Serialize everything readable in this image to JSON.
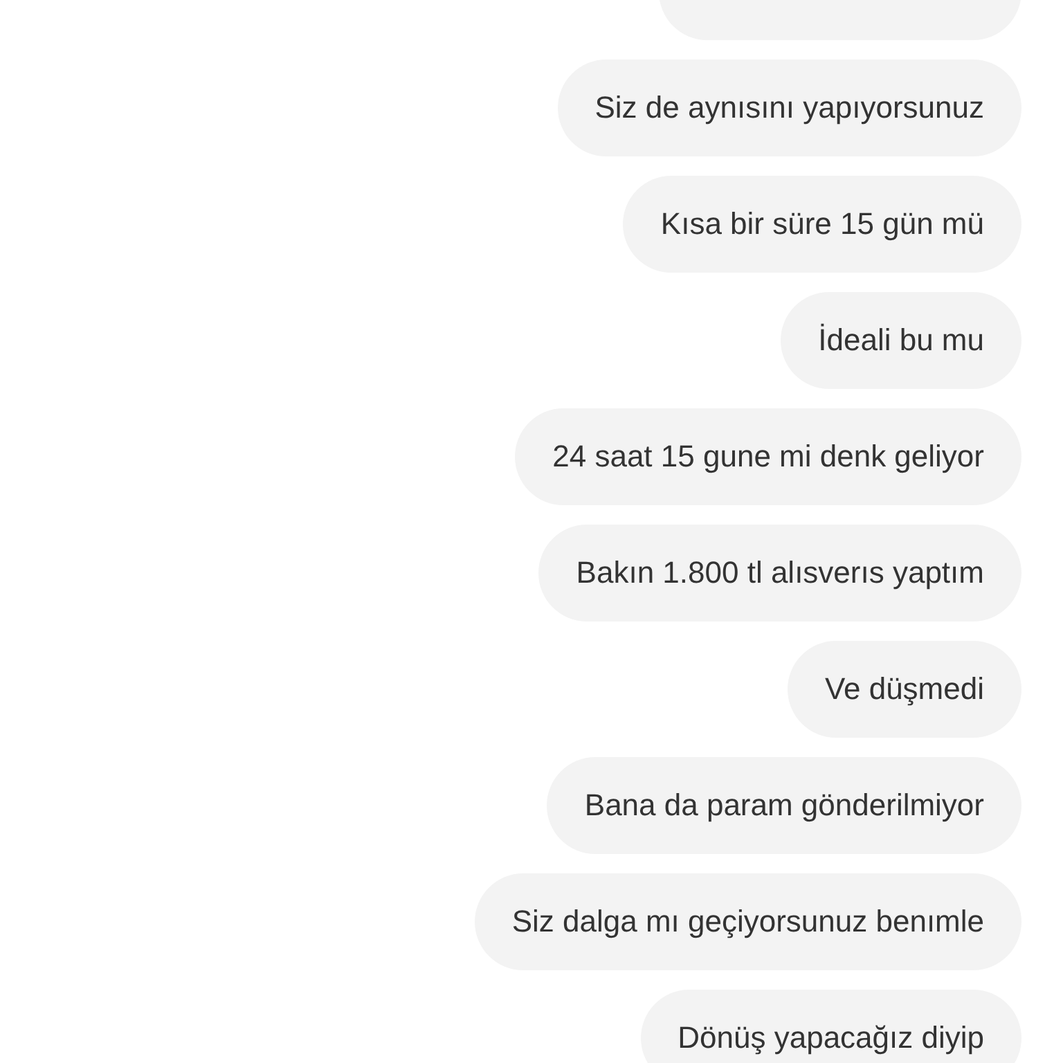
{
  "partial_message_above": true,
  "messages": [
    {
      "text": "Siz de aynısını yapıyorsunuz"
    },
    {
      "text": "Kısa bir süre 15 gün mü"
    },
    {
      "text": "İdeali bu mu"
    },
    {
      "text": "24 saat 15 gune mi denk geliyor"
    },
    {
      "text": "Bakın 1.800 tl alısverıs yaptım"
    },
    {
      "text": "Ve düşmedi"
    },
    {
      "text": "Bana da param gönderilmiyor"
    },
    {
      "text": "Siz dalga mı geçiyorsunuz benımle"
    },
    {
      "text": "Dönüş yapacağız diyip"
    }
  ]
}
